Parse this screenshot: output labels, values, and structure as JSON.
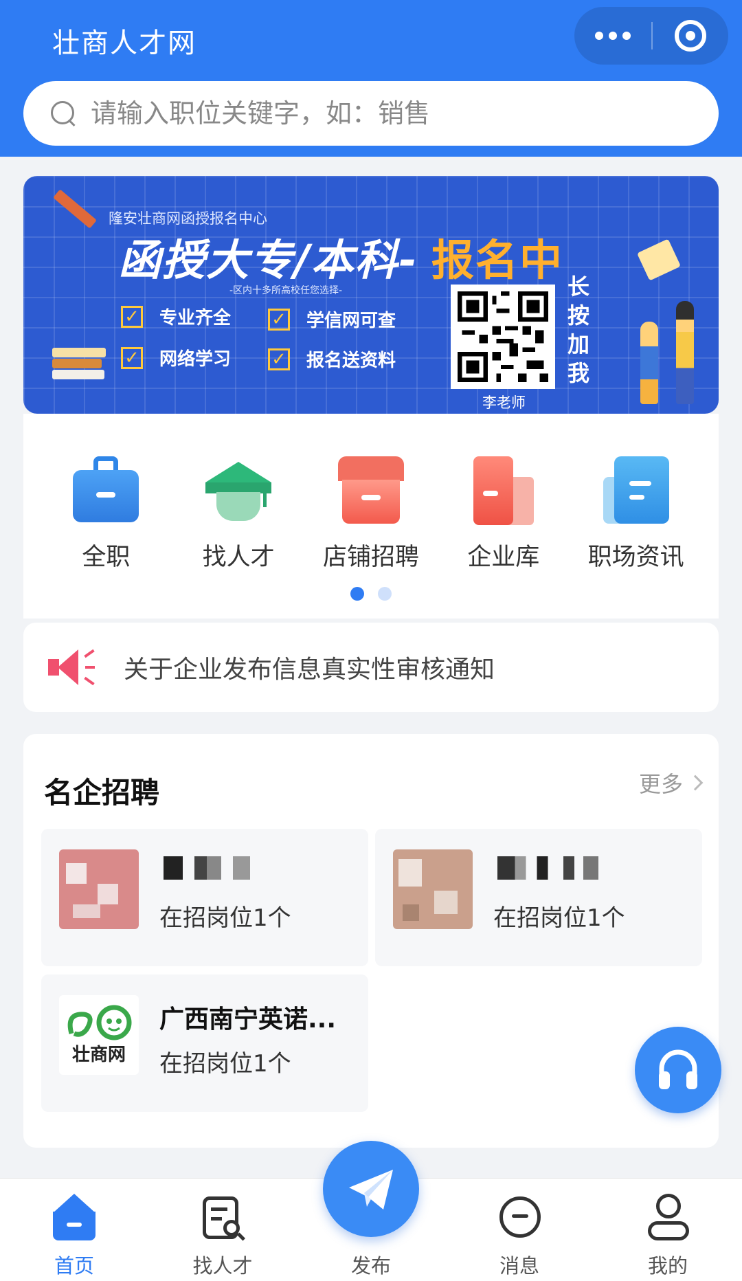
{
  "app": {
    "title": "壮商人才网"
  },
  "search": {
    "placeholder": "请输入职位关键字，如：销售"
  },
  "banner": {
    "subtitle": "隆安壮商网函授报名中心",
    "headline": "函授大专/本科-",
    "headline_highlight": "报名中",
    "note": "-区内十多所高校任您选择-",
    "features": [
      "专业齐全",
      "学信网可查",
      "网络学习",
      "报名送资料"
    ],
    "qr_name": "李老师",
    "long_press": "长按加我"
  },
  "categories": [
    {
      "label": "全职",
      "icon": "briefcase-icon",
      "color": "#2f86e8"
    },
    {
      "label": "找人才",
      "icon": "graduation-cap-icon",
      "color": "#35b27a"
    },
    {
      "label": "店铺招聘",
      "icon": "store-icon",
      "color": "#f05a4f"
    },
    {
      "label": "企业库",
      "icon": "building-icon",
      "color": "#f07068"
    },
    {
      "label": "职场资讯",
      "icon": "news-icon",
      "color": "#3aa2ec"
    }
  ],
  "pager": {
    "pages": 2,
    "active": 1
  },
  "notice": {
    "text": "关于企业发布信息真实性审核通知",
    "icon": "speaker-icon"
  },
  "famous": {
    "title": "名企招聘",
    "more": "更多",
    "companies": [
      {
        "name": "",
        "jobs": "在招岗位1个"
      },
      {
        "name": "",
        "jobs": "在招岗位1个"
      },
      {
        "name": "广西南宁英诺...",
        "jobs": "在招岗位1个",
        "logo_text": "壮商网"
      }
    ]
  },
  "tabbar": {
    "items": [
      {
        "label": "首页",
        "icon": "home-icon",
        "active": true
      },
      {
        "label": "找人才",
        "icon": "search-doc-icon",
        "active": false
      },
      {
        "label": "发布",
        "icon": "paper-plane-icon",
        "active": false
      },
      {
        "label": "消息",
        "icon": "message-icon",
        "active": false
      },
      {
        "label": "我的",
        "icon": "user-icon",
        "active": false
      }
    ]
  },
  "colors": {
    "primary": "#2f7cf3",
    "banner": "#2d5bd1",
    "highlight": "#ffb02e",
    "speaker": "#f0506e"
  }
}
